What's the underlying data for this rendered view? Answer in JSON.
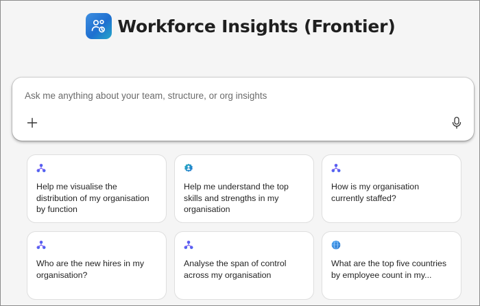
{
  "header": {
    "title": "Workforce Insights (Frontier)",
    "icon": "people-insights-icon"
  },
  "prompt": {
    "placeholder": "Ask me anything about your team, structure, or org insights",
    "value": "",
    "add_icon": "plus-icon",
    "mic_icon": "microphone-icon"
  },
  "colors": {
    "accent": "#1e6fd0",
    "background": "#f5f5f5",
    "card_bg": "#ffffff"
  },
  "suggestions": [
    {
      "icon": "org-chart-icon",
      "text": "Help me visualise the distribution of my organisation by function"
    },
    {
      "icon": "skills-badge-icon",
      "text": "Help me understand the top skills and strengths in my organisation"
    },
    {
      "icon": "org-chart-icon",
      "text": "How is my organisation currently staffed?"
    },
    {
      "icon": "org-chart-icon",
      "text": "Who are the new hires in my organisation?"
    },
    {
      "icon": "org-chart-icon",
      "text": "Analyse the span of control across my organisation"
    },
    {
      "icon": "globe-icon",
      "text": "What are the top five countries by employee count in my..."
    }
  ]
}
